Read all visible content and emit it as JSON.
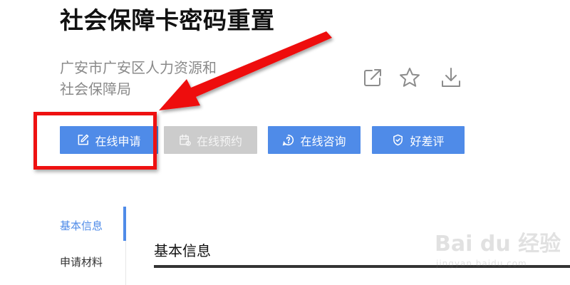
{
  "page": {
    "title": "社会保障卡密码重置",
    "org_line1": "广安市广安区人力资源和",
    "org_line2": "社会保障局"
  },
  "top_actions": [
    "share-icon",
    "star-icon",
    "download-icon"
  ],
  "buttons": {
    "apply_label": "在线申请",
    "reserve_label": "在线预约",
    "consult_label": "在线咨询",
    "review_label": "好差评"
  },
  "side_nav": {
    "items": [
      {
        "label": "基本信息",
        "active": true
      },
      {
        "label": "申请材料",
        "active": false
      }
    ]
  },
  "section": {
    "title": "基本信息"
  },
  "watermark": {
    "logo": "Bai du 经验",
    "sub": "jingyan.baidu.com"
  },
  "colors": {
    "accent": "#4f8be8",
    "disabled": "#cccccc",
    "annotation": "#ee1111"
  }
}
